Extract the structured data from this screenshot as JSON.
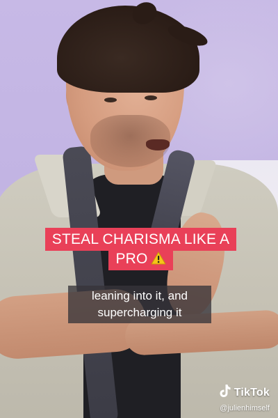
{
  "video": {
    "headline_line1": "STEAL CHARISMA LIKE A",
    "headline_line2": "PRO",
    "headline_icon": "warning-icon",
    "caption_line1": "leaning into it, and",
    "caption_line2": "supercharging it"
  },
  "watermark": {
    "brand_icon": "tiktok-logo-icon",
    "brand": "TikTok",
    "handle": "@julienhimself"
  },
  "colors": {
    "headline_bg": "#e94058",
    "caption_bg": "rgba(55,52,58,0.78)",
    "backdrop": "#c7b9e6",
    "warning": "#f5c518"
  }
}
